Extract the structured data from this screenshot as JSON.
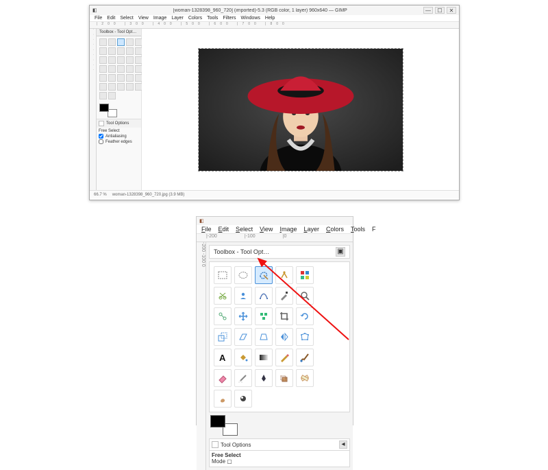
{
  "app": {
    "title": "[woman-1328398_960_720] (imported)-5.3 (RGB color, 1 layer) 960x640 — GIMP"
  },
  "menubar": [
    "File",
    "Edit",
    "Select",
    "View",
    "Image",
    "Layer",
    "Colors",
    "Tools",
    "Filters",
    "Windows",
    "Help"
  ],
  "ruler_ticks": "|200 |300 |400 |500 |600 |700 |800",
  "toolbox": {
    "title": "Toolbox - Tool Opt…"
  },
  "tool_options": {
    "header": "Tool Options",
    "tool_name": "Free Select",
    "antialiasing_label": "Antialiasing",
    "feather_label": "Feather edges",
    "antialiasing_checked": true,
    "feather_checked": false
  },
  "statusbar": {
    "zoom": "66.7 %",
    "file": "woman-1328398_960_720.jpg (3.9 MB)"
  },
  "zoom": {
    "menubar": [
      "File",
      "Edit",
      "Select",
      "View",
      "Image",
      "Layer",
      "Colors",
      "Tools",
      "F"
    ],
    "ruler_a": "|-200",
    "ruler_b": "|-100",
    "ruler_c": "|0",
    "mode_label": "Mode"
  },
  "tools_big": [
    "rect-select",
    "ellipse-select",
    "free-select",
    "fuzzy-select",
    "color-select",
    "scissors",
    "foreground",
    "paths",
    "color-picker",
    "zoom",
    "measure",
    "move",
    "align",
    "crop",
    "rotate",
    "scale",
    "shear",
    "perspective",
    "flip",
    "cage",
    "text",
    "bucket",
    "gradient",
    "pencil",
    "paintbrush",
    "eraser",
    "airbrush",
    "ink",
    "clone",
    "heal",
    "smudge",
    "dodge"
  ]
}
